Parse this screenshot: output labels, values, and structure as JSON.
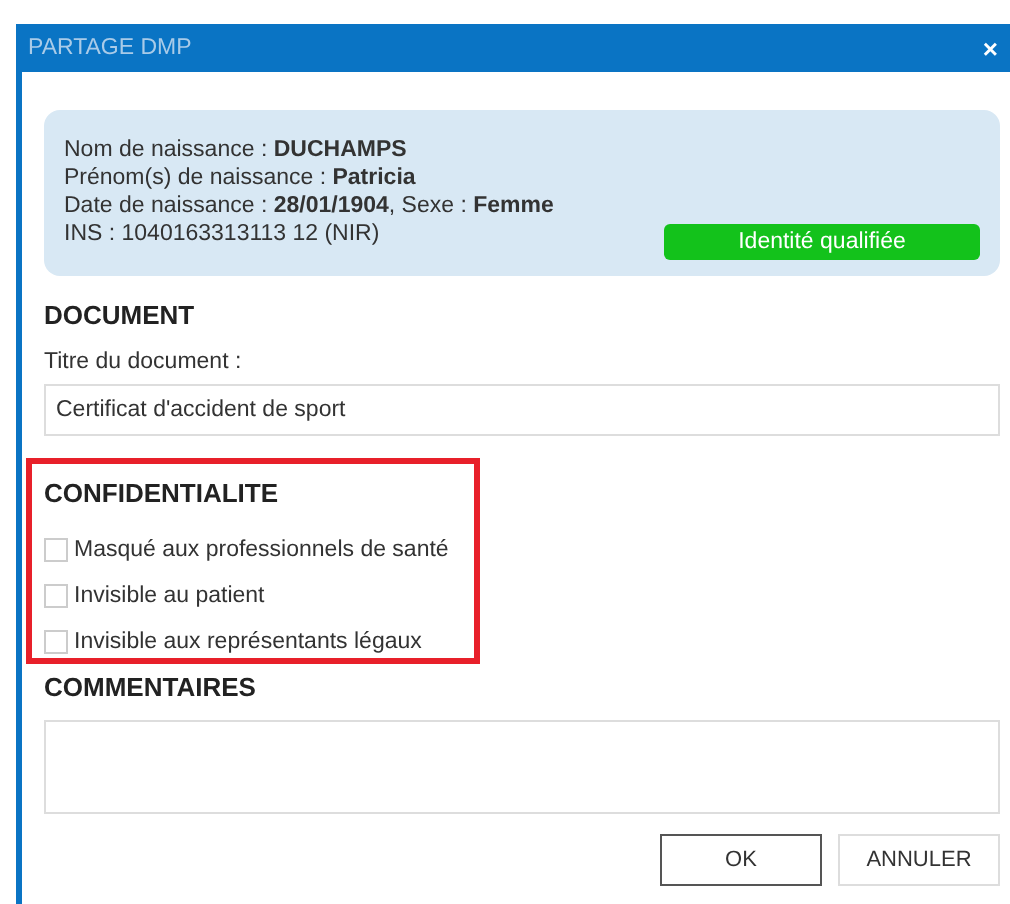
{
  "window": {
    "title": "PARTAGE DMP",
    "close": "×"
  },
  "patient": {
    "lines": [
      "Nom de naissance : **DUCHAMPS**",
      "Prénom(s) de naissance : **Patricia**",
      "Date de naissance : **28/01/1904**, Sexe : **Femme**",
      "INS : 1040163313113 12 (NIR)"
    ],
    "status": "Identité qualifiée"
  },
  "document": {
    "heading": "DOCUMENT",
    "label": "Titre du document :",
    "value": "Certificat d'accident de sport"
  },
  "confidentiality": {
    "heading": "CONFIDENTIALITE",
    "options": [
      {
        "label": "Masqué aux professionnels de santé",
        "checked": false
      },
      {
        "label": "Invisible au patient",
        "checked": false
      },
      {
        "label": "Invisible aux représentants légaux",
        "checked": false
      }
    ]
  },
  "comments": {
    "heading": "COMMENTAIRES"
  },
  "buttons": [
    {
      "label": "OK",
      "default": true
    },
    {
      "label": "ANNULER",
      "default": false
    }
  ]
}
